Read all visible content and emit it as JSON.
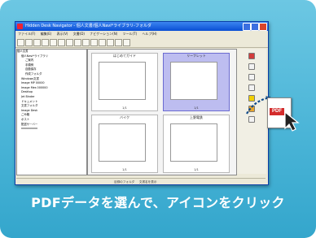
{
  "window": {
    "title": "Hidden Desk Navigator - 個人文書/個人Navi*ライブラリ-フォルダ"
  },
  "menu": [
    "ファイル(F)",
    "編集(E)",
    "表示(V)",
    "文書(D)",
    "ナビゲーション(N)",
    "ツール(T)",
    "ヘルプ(H)"
  ],
  "tree": [
    "個人文書",
    "個人Navi*ライブラリ",
    "ご案内",
    "手順例",
    "自動保存",
    "作成フォルダ",
    "Windows文書",
    "Image MP 00000",
    "Image Mes 000000",
    "Desktop",
    "Jet Binder",
    "ドキュメント",
    "文書フォルダ",
    "Image Desk",
    "ごみ箱",
    "ポスト",
    "配送サーバー",
    "xxxxxxxxxx"
  ],
  "thumbnails": [
    {
      "label": "はじめてガイド",
      "page": "1/1"
    },
    {
      "label": "リーフレット",
      "page": "1/1"
    },
    {
      "label": "バイク",
      "page": "1/1"
    },
    {
      "label": "上野電鉄",
      "page": "1/1"
    }
  ],
  "status": {
    "left": "目録のフォルダ",
    "right": "文書名を表示"
  },
  "pdf_icon": {
    "label": "PDF"
  },
  "caption": "PDFデータを選んで、アイコンをクリック"
}
